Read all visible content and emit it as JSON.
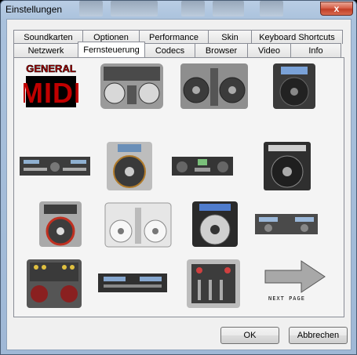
{
  "window": {
    "title": "Einstellungen",
    "close_symbol": "x"
  },
  "tabs": {
    "row1": [
      "Soundkarten",
      "Optionen",
      "Performance",
      "Skin",
      "Keyboard Shortcuts"
    ],
    "row2": [
      "Netzwerk",
      "Fernsteuerung",
      "Codecs",
      "Browser",
      "Video",
      "Info"
    ],
    "active": "Fernsteuerung"
  },
  "remote_control": {
    "logo": {
      "line1": "GENERAL",
      "line2": "MIDI"
    },
    "next_page_label": "NEXT PAGE"
  },
  "buttons": {
    "ok": "OK",
    "cancel": "Abbrechen"
  },
  "colors": {
    "logo_red": "#c00000",
    "title_bar": "#a9c1dc",
    "close_red": "#c13f26"
  }
}
